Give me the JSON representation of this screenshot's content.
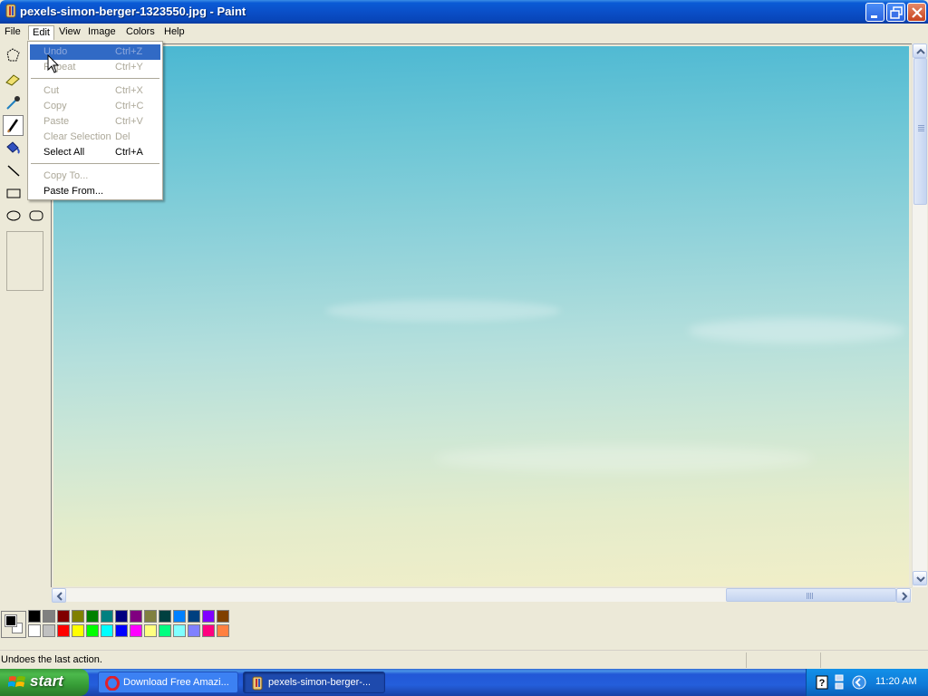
{
  "window": {
    "title": "pexels-simon-berger-1323550.jpg - Paint"
  },
  "menubar": {
    "file": "File",
    "edit": "Edit",
    "view": "View",
    "image": "Image",
    "colors": "Colors",
    "help": "Help"
  },
  "edit_menu": {
    "items": [
      {
        "label": "Undo",
        "shortcut": "Ctrl+Z",
        "enabled": false,
        "highlighted": true
      },
      {
        "label": "Repeat",
        "shortcut": "Ctrl+Y",
        "enabled": false
      },
      {
        "label": "Cut",
        "shortcut": "Ctrl+X",
        "enabled": false
      },
      {
        "label": "Copy",
        "shortcut": "Ctrl+C",
        "enabled": false
      },
      {
        "label": "Paste",
        "shortcut": "Ctrl+V",
        "enabled": false
      },
      {
        "label": "Clear Selection",
        "shortcut": "Del",
        "enabled": false
      },
      {
        "label": "Select All",
        "shortcut": "Ctrl+A",
        "enabled": true
      },
      {
        "label": "Copy To...",
        "shortcut": "",
        "enabled": false
      },
      {
        "label": "Paste From...",
        "shortcut": "",
        "enabled": true
      }
    ]
  },
  "toolbox": {
    "tools": [
      "free-select",
      "eraser",
      "color-picker",
      "pencil",
      "fill",
      "line",
      "rectangle",
      "ellipse",
      "rounded-rectangle"
    ],
    "selected": "pencil"
  },
  "palette": {
    "foreground": "#000000",
    "background": "#ffffff",
    "row1": [
      "#000000",
      "#808080",
      "#800000",
      "#808000",
      "#008000",
      "#008080",
      "#000080",
      "#800080",
      "#808040",
      "#004040",
      "#0080ff",
      "#004080",
      "#8000ff",
      "#804000"
    ],
    "row2": [
      "#ffffff",
      "#c0c0c0",
      "#ff0000",
      "#ffff00",
      "#00ff00",
      "#00ffff",
      "#0000ff",
      "#ff00ff",
      "#ffff80",
      "#00ff80",
      "#80ffff",
      "#8080ff",
      "#ff0080",
      "#ff8040"
    ]
  },
  "status": {
    "text": "Undoes the last action."
  },
  "taskbar": {
    "start": "start",
    "tasks": [
      {
        "label": "Download Free Amazi...",
        "icon": "opera-icon"
      },
      {
        "label": "pexels-simon-berger-...",
        "icon": "paint-icon",
        "active": true
      }
    ],
    "clock": "11:20 AM"
  }
}
